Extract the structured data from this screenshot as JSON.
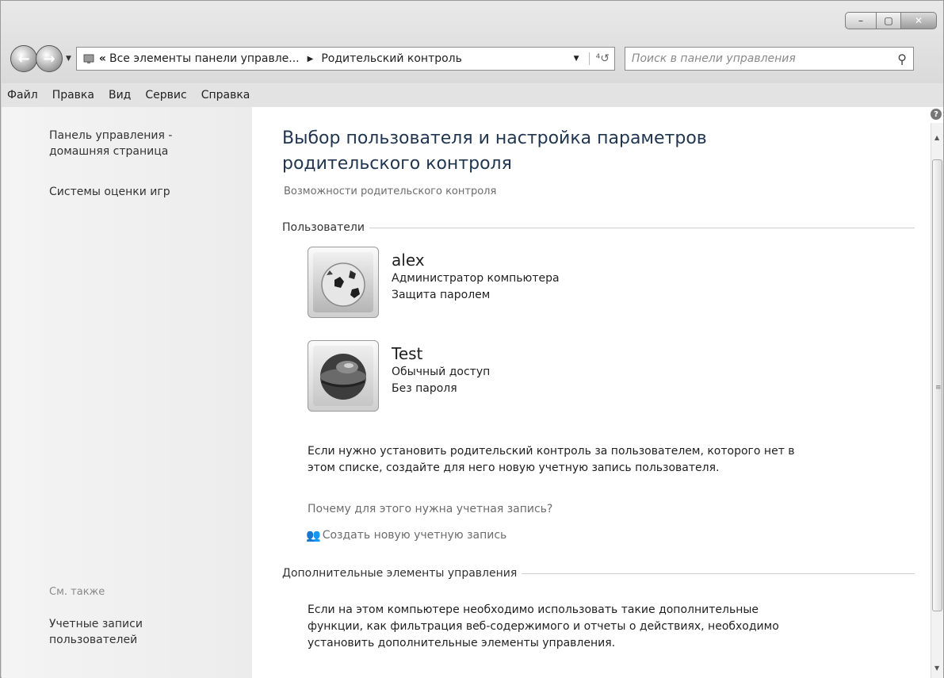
{
  "window": {
    "caption": {
      "minimize": "–",
      "maximize": "▢",
      "close": "✕"
    }
  },
  "navbar": {
    "back_icon": "back-arrow-icon",
    "forward_icon": "forward-arrow-icon",
    "address": {
      "chevron": "«",
      "crumb_1": "Все элементы панели управле...",
      "separator": "▶",
      "crumb_2": "Родительский контроль",
      "dropdown": "▼",
      "refresh": "⁴↺"
    },
    "search": {
      "placeholder": "Поиск в панели управления",
      "icon": "🔍"
    }
  },
  "menubar": {
    "items": [
      "Файл",
      "Правка",
      "Вид",
      "Сервис",
      "Справка"
    ]
  },
  "sidebar": {
    "home_link": "Панель управления - домашняя страница",
    "games_link": "Системы оценки игр",
    "see_also": "См. также",
    "accounts_link": "Учетные записи пользователей"
  },
  "main": {
    "title": "Выбор пользователя и настройка параметров родительского контроля",
    "features_link": "Возможности родительского контроля",
    "users_section": "Пользователи",
    "users": [
      {
        "name": "alex",
        "role": "Администратор компьютера",
        "password": "Защита паролем",
        "avatar": "soccer-ball"
      },
      {
        "name": "Test",
        "role": "Обычный доступ",
        "password": "Без пароля",
        "avatar": "globe-sphere"
      }
    ],
    "info_text": "Если нужно установить родительский контроль за пользователем, которого нет в этом списке, создайте для него новую учетную запись пользователя.",
    "why_link": "Почему для этого нужна учетная запись?",
    "create_link": "Создать новую учетную запись",
    "extra_section": "Дополнительные элементы управления",
    "extra_text": "Если на этом компьютере необходимо использовать такие дополнительные функции, как фильтрация веб-содержимого и отчеты о действиях, необходимо установить дополнительные элементы управления."
  },
  "colors": {
    "title": "#1f3550",
    "link": "#6c6c6c",
    "sidebar_bg": "#f0f0f0"
  }
}
